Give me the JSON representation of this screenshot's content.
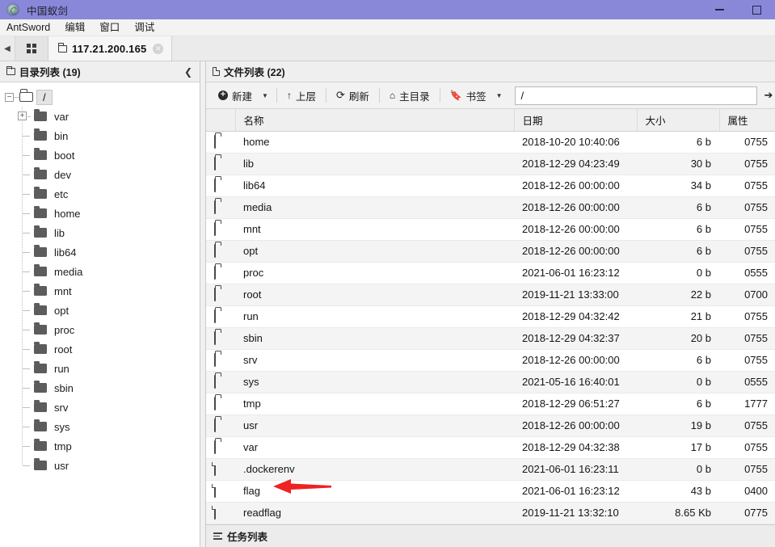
{
  "window": {
    "title": "中国蚁剑",
    "app_icon": "antsword-logo-icon",
    "minimize_label": "最小化",
    "maximize_label": "最大化"
  },
  "menubar": {
    "items": [
      {
        "label": "AntSword"
      },
      {
        "label": "编辑"
      },
      {
        "label": "窗口"
      },
      {
        "label": "调试"
      }
    ]
  },
  "tabbar": {
    "nav_arrow": "◀",
    "grid_button_label": "grid",
    "tabs": [
      {
        "label": "117.21.200.165",
        "close": "✕",
        "active": true
      }
    ]
  },
  "sidebar": {
    "header": {
      "title": "目录列表 (19)",
      "collapse": "❮"
    },
    "root": {
      "label": "/",
      "expander": "−",
      "selected": true
    },
    "items": [
      {
        "label": "var",
        "expandable": true,
        "expander": "+"
      },
      {
        "label": "bin",
        "expandable": false
      },
      {
        "label": "boot",
        "expandable": false
      },
      {
        "label": "dev",
        "expandable": false
      },
      {
        "label": "etc",
        "expandable": false
      },
      {
        "label": "home",
        "expandable": false
      },
      {
        "label": "lib",
        "expandable": false
      },
      {
        "label": "lib64",
        "expandable": false
      },
      {
        "label": "media",
        "expandable": false
      },
      {
        "label": "mnt",
        "expandable": false
      },
      {
        "label": "opt",
        "expandable": false
      },
      {
        "label": "proc",
        "expandable": false
      },
      {
        "label": "root",
        "expandable": false
      },
      {
        "label": "run",
        "expandable": false
      },
      {
        "label": "sbin",
        "expandable": false
      },
      {
        "label": "srv",
        "expandable": false
      },
      {
        "label": "sys",
        "expandable": false
      },
      {
        "label": "tmp",
        "expandable": false
      },
      {
        "label": "usr",
        "expandable": false
      }
    ]
  },
  "filepanel": {
    "header": {
      "title": "文件列表 (22)"
    },
    "toolbar": {
      "new_label": "新建",
      "new_caret": "▼",
      "up_label": "上层",
      "refresh_label": "刷新",
      "home_label": "主目录",
      "bookmark_label": "书签",
      "bookmark_caret": "▼",
      "path_value": "/",
      "path_placeholder": "/",
      "go_label": "➔"
    },
    "columns": {
      "icon": "",
      "name": "名称",
      "date": "日期",
      "size": "大小",
      "attr": "属性"
    },
    "rows": [
      {
        "type": "folder",
        "name": "home",
        "date": "2018-10-20 10:40:06",
        "size": "6 b",
        "attr": "0755"
      },
      {
        "type": "folder",
        "name": "lib",
        "date": "2018-12-29 04:23:49",
        "size": "30 b",
        "attr": "0755"
      },
      {
        "type": "folder",
        "name": "lib64",
        "date": "2018-12-26 00:00:00",
        "size": "34 b",
        "attr": "0755"
      },
      {
        "type": "folder",
        "name": "media",
        "date": "2018-12-26 00:00:00",
        "size": "6 b",
        "attr": "0755"
      },
      {
        "type": "folder",
        "name": "mnt",
        "date": "2018-12-26 00:00:00",
        "size": "6 b",
        "attr": "0755"
      },
      {
        "type": "folder",
        "name": "opt",
        "date": "2018-12-26 00:00:00",
        "size": "6 b",
        "attr": "0755"
      },
      {
        "type": "folder",
        "name": "proc",
        "date": "2021-06-01 16:23:12",
        "size": "0 b",
        "attr": "0555"
      },
      {
        "type": "folder",
        "name": "root",
        "date": "2019-11-21 13:33:00",
        "size": "22 b",
        "attr": "0700"
      },
      {
        "type": "folder",
        "name": "run",
        "date": "2018-12-29 04:32:42",
        "size": "21 b",
        "attr": "0755"
      },
      {
        "type": "folder",
        "name": "sbin",
        "date": "2018-12-29 04:32:37",
        "size": "20 b",
        "attr": "0755"
      },
      {
        "type": "folder",
        "name": "srv",
        "date": "2018-12-26 00:00:00",
        "size": "6 b",
        "attr": "0755"
      },
      {
        "type": "folder",
        "name": "sys",
        "date": "2021-05-16 16:40:01",
        "size": "0 b",
        "attr": "0555"
      },
      {
        "type": "folder",
        "name": "tmp",
        "date": "2018-12-29 06:51:27",
        "size": "6 b",
        "attr": "1777"
      },
      {
        "type": "folder",
        "name": "usr",
        "date": "2018-12-26 00:00:00",
        "size": "19 b",
        "attr": "0755"
      },
      {
        "type": "folder",
        "name": "var",
        "date": "2018-12-29 04:32:38",
        "size": "17 b",
        "attr": "0755"
      },
      {
        "type": "file",
        "name": ".dockerenv",
        "date": "2021-06-01 16:23:11",
        "size": "0 b",
        "attr": "0755"
      },
      {
        "type": "file",
        "name": "flag",
        "date": "2021-06-01 16:23:12",
        "size": "43 b",
        "attr": "0400"
      },
      {
        "type": "file",
        "name": "readflag",
        "date": "2019-11-21 13:32:10",
        "size": "8.65 Kb",
        "attr": "0775"
      }
    ]
  },
  "statusbar": {
    "task_list_label": "任务列表"
  },
  "annotation": {
    "arrow_color": "#ee2222",
    "points_to": "flag"
  },
  "colors": {
    "titlebar": "#8988d8",
    "toolbar_bg": "#f2f2f2",
    "panel_bg": "#ffffff",
    "row_alt": "#f4f4f4",
    "accent_red": "#ee2222"
  }
}
